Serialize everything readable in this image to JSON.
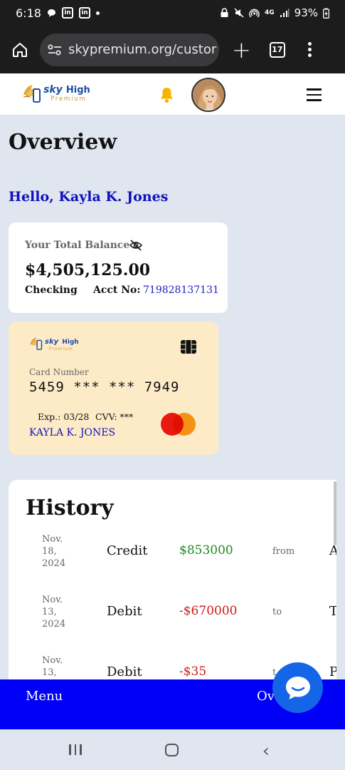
{
  "status_bar": {
    "time": "6:18",
    "network": "4G",
    "battery": "93%"
  },
  "browser": {
    "url": "skypremium.org/custor",
    "tab_count": "17"
  },
  "header": {
    "logo": {
      "sky": "sky",
      "high": "High",
      "premium": "Premium"
    }
  },
  "page": {
    "title": "Overview",
    "greeting": "Hello, Kayla K. Jones"
  },
  "balance": {
    "label": "Your Total Balance",
    "amount": "$4,505,125.00",
    "account_type": "Checking",
    "acct_label": "Acct No:",
    "acct_number": "719828137131"
  },
  "card": {
    "logo": {
      "sky": "sky",
      "high": "High",
      "premium": "Premium"
    },
    "number_label": "Card Number",
    "number": "5459 *** *** 7949",
    "expiry": "Exp.: 03/28",
    "cvv": "CVV: ***",
    "holder": "KAYLA K. JONES"
  },
  "history": {
    "title": "History",
    "rows": [
      {
        "date_line1": "Nov.",
        "date_line2": "18,",
        "date_line3": "2024",
        "type": "Credit",
        "amount": "$853000",
        "direction": "from",
        "party": "A"
      },
      {
        "date_line1": "Nov.",
        "date_line2": "13,",
        "date_line3": "2024",
        "type": "Debit",
        "amount": "-$670000",
        "direction": "to",
        "party": "T"
      },
      {
        "date_line1": "Nov.",
        "date_line2": "13,",
        "date_line3": "",
        "type": "Debit",
        "amount": "-$35",
        "direction": "t",
        "party": "P"
      }
    ]
  },
  "bottom_nav": {
    "menu": "Menu",
    "overview": "Ov"
  },
  "colors": {
    "nav_blue": "#0000f6",
    "credit_green": "#1c8a1c",
    "debit_red": "#d01919",
    "card_bg": "#fdebc8",
    "accent_blue": "#1111bb"
  }
}
